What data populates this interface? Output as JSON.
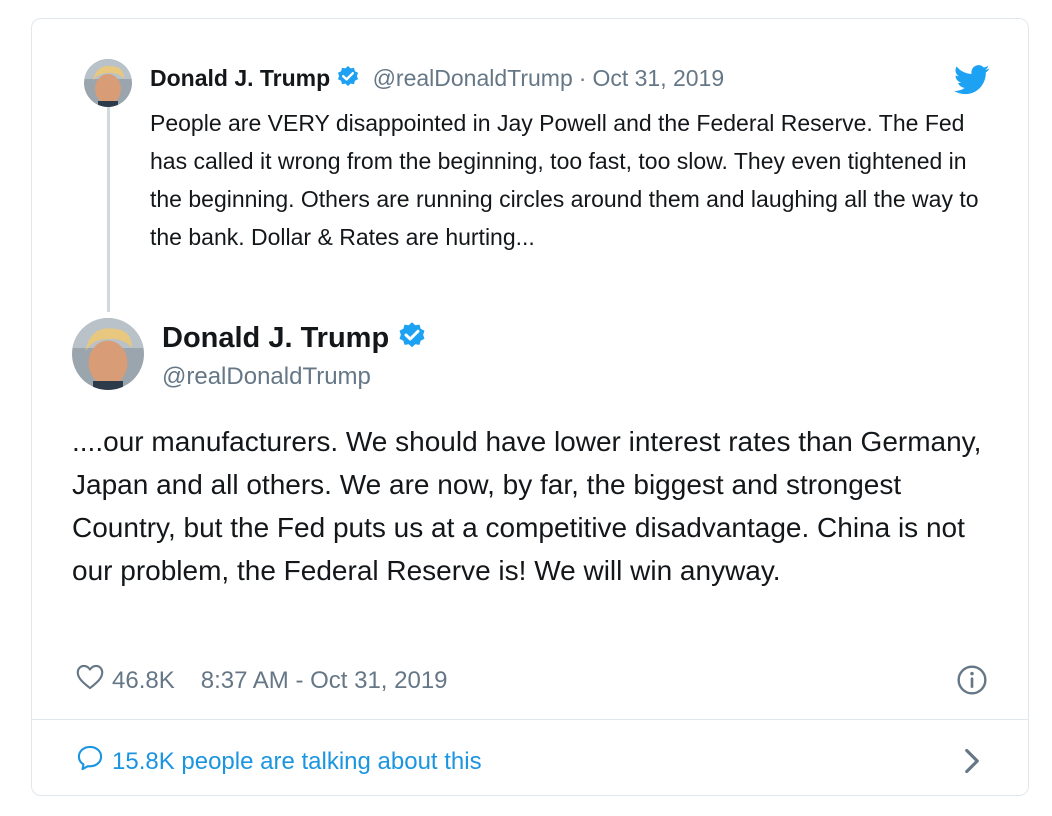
{
  "quoted": {
    "name": "Donald J. Trump",
    "handle": "@realDonaldTrump",
    "separator": "·",
    "date": "Oct 31, 2019",
    "text": "People are VERY disappointed in Jay Powell and the Federal Reserve. The Fed has called it wrong from the beginning, too fast, too slow. They even tightened in the beginning. Others are running circles around them and laughing all the way to the bank. Dollar & Rates are hurting..."
  },
  "main": {
    "name": "Donald J. Trump",
    "handle": "@realDonaldTrump",
    "text": "....our manufacturers. We should have lower interest rates than Germany, Japan and all others. We are now, by far, the biggest and strongest Country, but the Fed puts us at a competitive disadvantage. China is not our problem, the Federal Reserve is! We will win anyway."
  },
  "footer": {
    "likes": "46.8K",
    "timestamp": "8:37 AM - Oct 31, 2019",
    "talking": "15.8K people are talking about this"
  },
  "icons": {
    "verified": "verified-badge-icon",
    "twitter": "twitter-bird-icon",
    "like": "heart-icon",
    "info": "info-icon",
    "reply": "speech-bubble-icon",
    "more": "chevron-right-icon"
  },
  "colors": {
    "accent": "#1da1f2",
    "link": "#1b95e0",
    "text": "#14171a",
    "muted": "#657786",
    "border": "#e1e8ed"
  }
}
